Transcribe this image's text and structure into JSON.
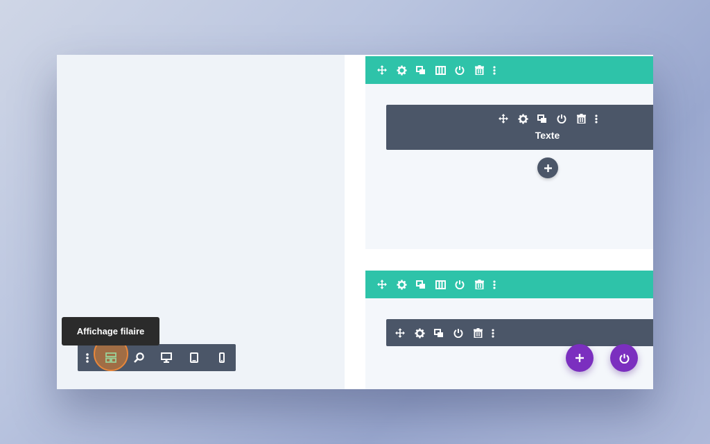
{
  "builder": {
    "sections": [
      {
        "toolbar_icons": [
          "move-icon",
          "gear-icon",
          "duplicate-icon",
          "columns-icon",
          "power-icon",
          "trash-icon",
          "more-icon"
        ],
        "module": {
          "toolbar_icons": [
            "move-icon",
            "gear-icon",
            "duplicate-icon",
            "power-icon",
            "trash-icon",
            "more-icon"
          ],
          "label": "Texte"
        },
        "add_module_icon": "plus-icon"
      },
      {
        "toolbar_icons": [
          "move-icon",
          "gear-icon",
          "duplicate-icon",
          "columns-icon",
          "power-icon",
          "trash-icon",
          "more-icon"
        ],
        "module": {
          "toolbar_icons": [
            "move-icon",
            "gear-icon",
            "duplicate-icon",
            "power-icon",
            "trash-icon",
            "more-icon"
          ]
        }
      }
    ]
  },
  "bottom_bar": {
    "tooltip": "Affichage filaire",
    "items": [
      "more-icon",
      "wireframe-icon",
      "zoom-icon",
      "desktop-icon",
      "tablet-icon",
      "phone-icon"
    ]
  },
  "fabs": [
    "add-icon",
    "power-icon"
  ],
  "colors": {
    "teal": "#2ec3a9",
    "slate": "#4b5668",
    "purple": "#7b2fbf",
    "highlight": "#e8873b",
    "tooltip_bg": "#2b2b2b"
  }
}
